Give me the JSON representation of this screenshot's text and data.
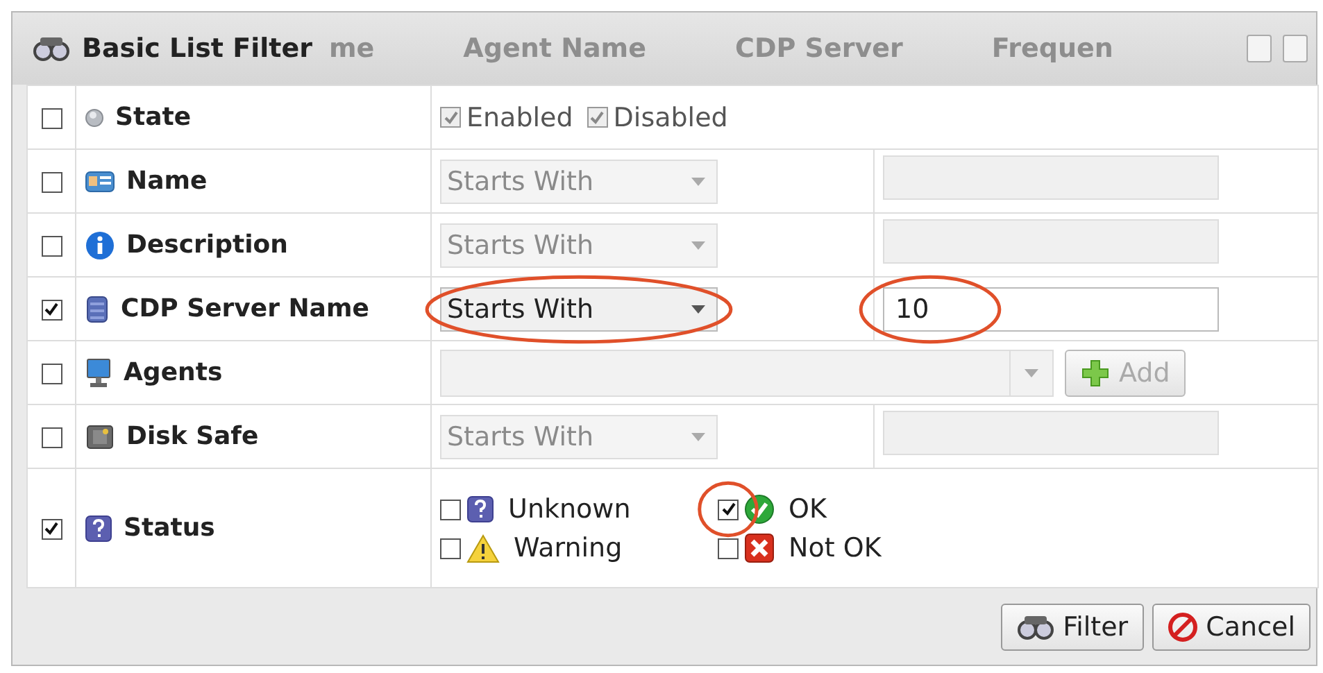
{
  "dialog": {
    "title": "Basic List Filter",
    "background_headers": [
      "me",
      "Agent Name",
      "CDP Server",
      "Frequen"
    ]
  },
  "rows": [
    {
      "kind": "state",
      "label": "State",
      "checked": false,
      "options": [
        {
          "label": "Enabled",
          "checked": true
        },
        {
          "label": "Disabled",
          "checked": true
        }
      ]
    },
    {
      "kind": "text",
      "label": "Name",
      "checked": false,
      "operator": "Starts With"
    },
    {
      "kind": "text",
      "label": "Description",
      "checked": false,
      "operator": "Starts With"
    },
    {
      "kind": "text",
      "label": "CDP Server Name",
      "checked": true,
      "operator": "Starts With",
      "operator_circled": true,
      "value": "10",
      "value_circled": true
    },
    {
      "kind": "list",
      "label": "Agents",
      "checked": false,
      "button": "Add"
    },
    {
      "kind": "text",
      "label": "Disk Safe",
      "checked": false,
      "operator": "Starts With"
    },
    {
      "kind": "status",
      "label": "Status",
      "checked": true,
      "options": [
        {
          "label": "Unknown",
          "checked": false
        },
        {
          "label": "OK",
          "checked": true,
          "circled": true
        },
        {
          "label": "Warning",
          "checked": false
        },
        {
          "label": "Not OK",
          "checked": false
        }
      ]
    }
  ],
  "buttons": [
    {
      "label": "Filter"
    },
    {
      "label": "Cancel"
    }
  ]
}
